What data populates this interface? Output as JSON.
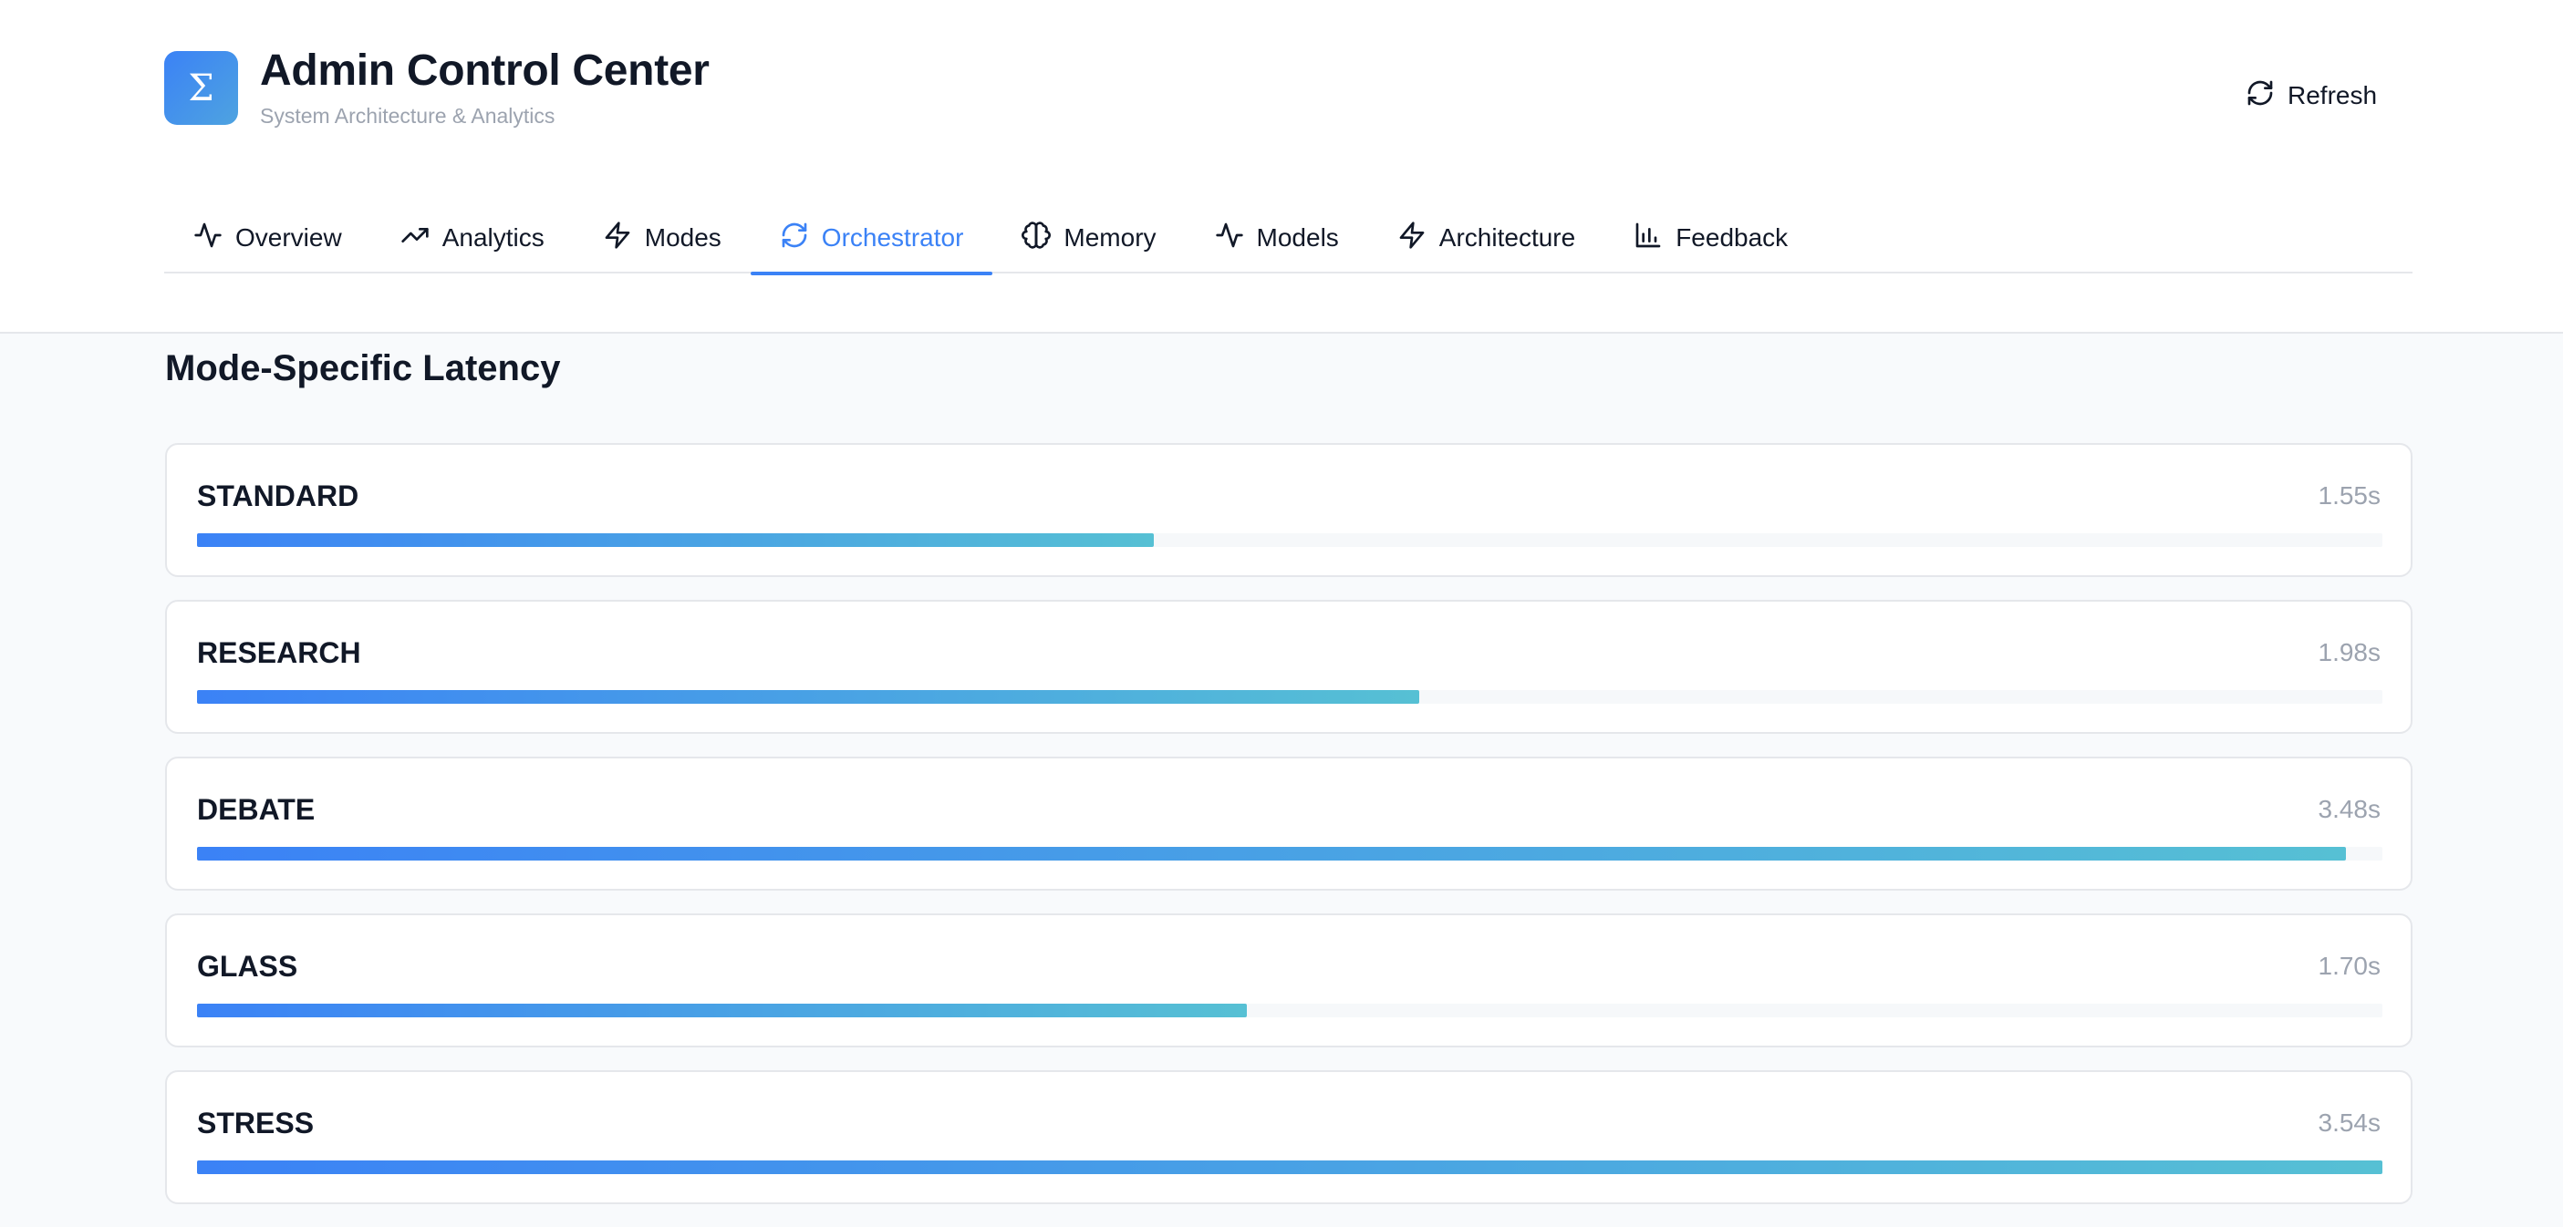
{
  "header": {
    "logo_glyph": "Σ",
    "title": "Admin Control Center",
    "subtitle": "System Architecture & Analytics",
    "refresh_label": "Refresh"
  },
  "tabs": [
    {
      "label": "Overview",
      "icon": "activity-icon",
      "active": false
    },
    {
      "label": "Analytics",
      "icon": "trending-up-icon",
      "active": false
    },
    {
      "label": "Modes",
      "icon": "zap-icon",
      "active": false
    },
    {
      "label": "Orchestrator",
      "icon": "refresh-icon",
      "active": true
    },
    {
      "label": "Memory",
      "icon": "brain-icon",
      "active": false
    },
    {
      "label": "Models",
      "icon": "activity-icon",
      "active": false
    },
    {
      "label": "Architecture",
      "icon": "zap-icon",
      "active": false
    },
    {
      "label": "Feedback",
      "icon": "bar-chart-icon",
      "active": false
    }
  ],
  "section": {
    "title": "Mode-Specific Latency"
  },
  "latency": {
    "max_seconds": 3.54,
    "modes": [
      {
        "name": "STANDARD",
        "value_label": "1.55s",
        "seconds": 1.55
      },
      {
        "name": "RESEARCH",
        "value_label": "1.98s",
        "seconds": 1.98
      },
      {
        "name": "DEBATE",
        "value_label": "3.48s",
        "seconds": 3.48
      },
      {
        "name": "GLASS",
        "value_label": "1.70s",
        "seconds": 1.7
      },
      {
        "name": "STRESS",
        "value_label": "3.54s",
        "seconds": 3.54
      }
    ]
  },
  "colors": {
    "accent": "#3b82f6",
    "gradient_start": "#3b82f6",
    "gradient_end": "#56c0d4",
    "muted_text": "#9ca3af"
  }
}
